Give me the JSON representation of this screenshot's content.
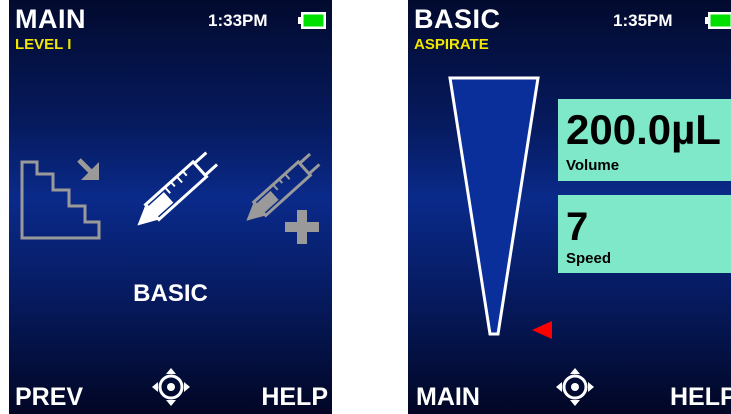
{
  "screens": [
    {
      "title": "MAIN",
      "subtitle": "LEVEL I",
      "time": "1:33PM",
      "mode_label": "BASIC",
      "softkeys": {
        "left": "PREV",
        "right": "HELP"
      }
    },
    {
      "title": "BASIC",
      "subtitle": "ASPIRATE",
      "time": "1:35PM",
      "params": [
        {
          "value": "200.0µL",
          "label": "Volume"
        },
        {
          "value": "7",
          "label": "Speed"
        }
      ],
      "softkeys": {
        "left": "MAIN",
        "right": "HELP"
      }
    }
  ],
  "colors": {
    "subtitle": "#f2e600",
    "battery": "#00e000",
    "param_bg": "#7ee8c8",
    "indicator": "#ff0000"
  },
  "icons": {
    "modes": [
      "step-program-icon",
      "basic-pipette-icon",
      "pipette-plus-icon"
    ],
    "nav": "navigation-joystick-icon",
    "battery": "battery-full-icon",
    "level_indicator": "red-triangle-pointer-icon"
  }
}
